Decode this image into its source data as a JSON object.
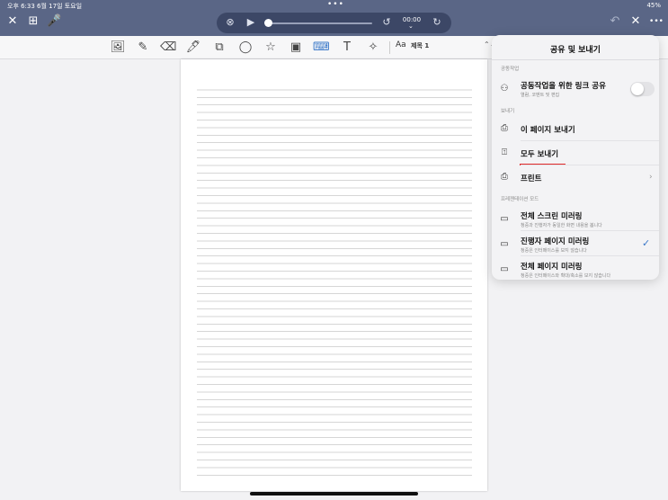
{
  "status": {
    "time_date": "오후 6:33   6월 17일 토요일",
    "dots": "•••",
    "right": "45%"
  },
  "topbar": {
    "close_icon": "✕",
    "grid_icon": "⊞",
    "mic_icon": "🎤",
    "undo_icon": "↶",
    "close2_icon": "✕",
    "more_icon": "•••"
  },
  "player": {
    "stop_icon": "⊗",
    "play_icon": "▶",
    "rewind_icon": "↺",
    "forward_icon": "↻",
    "time": "00:00",
    "chevron": "⌄",
    "progress": 0.0
  },
  "toolbar": {
    "tools": [
      "🖼",
      "✎",
      "⌫",
      "🖊",
      "⧉",
      "◯",
      "☆",
      "▣",
      "⌨",
      "T",
      "✧"
    ],
    "font_icon": "Aa",
    "font_name": "제목 1",
    "font_updown": "⌃⌄"
  },
  "popover": {
    "title": "공유 및 보내기",
    "section_collab": "공동작업",
    "collab_row": {
      "label": "공동작업을 위한 링크 공유",
      "sub": "열람, 코멘트 및 편집",
      "toggle_on": false
    },
    "section_send": "보내기",
    "send_this_page": "이 페이지 보내기",
    "send_all": "모두 보내기",
    "print": "프린트",
    "section_present": "프레젠테이션 모드",
    "mirror_full_screen": {
      "label": "전체 스크린 미러링",
      "sub": "청중과 진행자가 동일한 화면 내용을 봅니다"
    },
    "mirror_presenter_page": {
      "label": "진행자 페이지 미러링",
      "sub": "청중은 인터페이스를 보지 않습니다",
      "selected": true
    },
    "mirror_full_page": {
      "label": "전체 페이지 미러링",
      "sub": "청중은 인터페이스와 확대/축소를 보지 않습니다"
    },
    "check_icon": "✓",
    "chevron_right": "›"
  }
}
